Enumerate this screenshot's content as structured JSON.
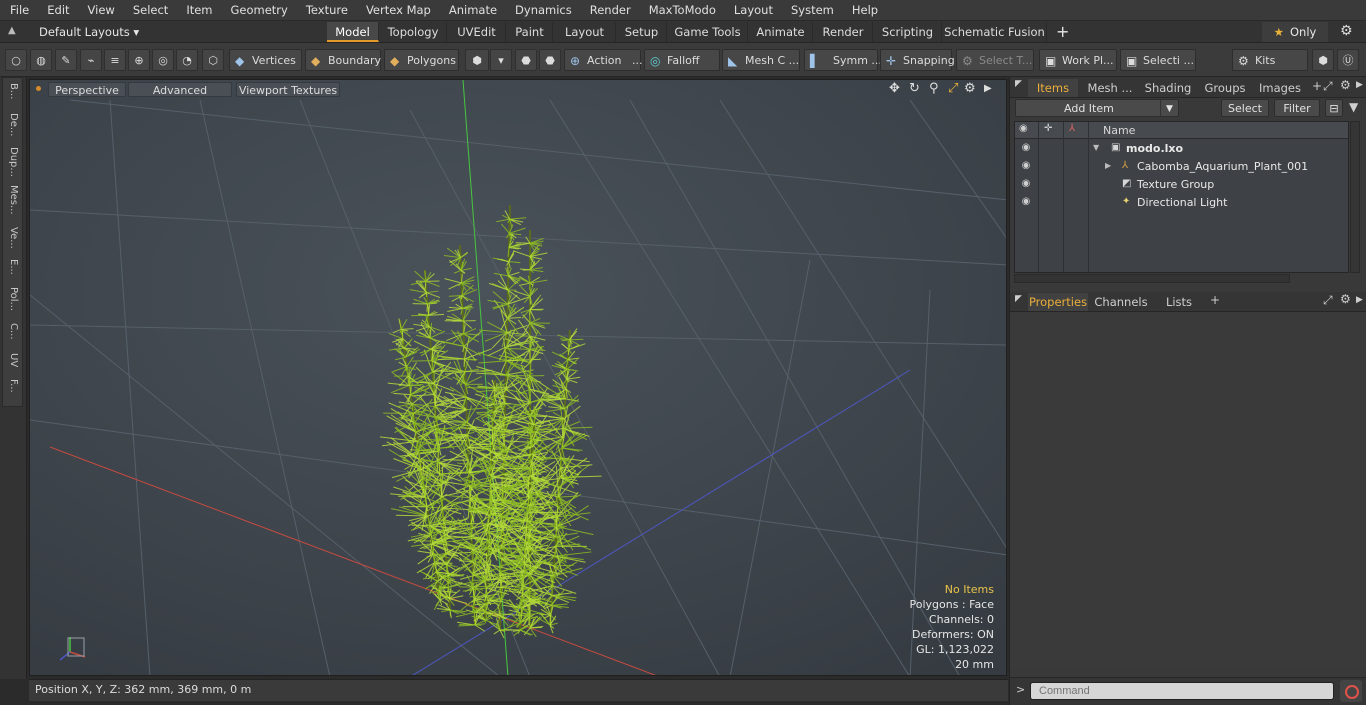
{
  "menubar": {
    "items": [
      "File",
      "Edit",
      "View",
      "Select",
      "Item",
      "Geometry",
      "Texture",
      "Vertex Map",
      "Animate",
      "Dynamics",
      "Render",
      "MaxToModo",
      "Layout",
      "System",
      "Help"
    ]
  },
  "layoutbar": {
    "layouts_label": "Default Layouts",
    "tabs": [
      "Model",
      "Topology",
      "UVEdit",
      "Paint",
      "Layout",
      "Setup",
      "Game Tools",
      "Animate",
      "Render",
      "Scripting",
      "Schematic Fusion"
    ],
    "active_tab": "Model",
    "plus": "+",
    "only_label": "Only"
  },
  "toolbar": {
    "vertices": "Vertices",
    "boundary": "Boundary",
    "polygons": "Polygons",
    "action": "Action",
    "action_more": "...",
    "falloff": "Falloff",
    "mesh_c": "Mesh C ...",
    "symm": "Symm ...",
    "snapping": "Snapping",
    "select_t": "Select T...",
    "work_pl": "Work Pl...",
    "selecti": "Selecti ...",
    "kits": "Kits"
  },
  "left_tabs": [
    "B...",
    "De...",
    "Dup...",
    "Mes...",
    "Ve...",
    "E...",
    "Pol...",
    "C...",
    "UV",
    "F..."
  ],
  "viewport": {
    "perspective": "Perspective",
    "advanced": "Advanced",
    "viewport_textures": "Viewport Textures",
    "info": {
      "no_items": "No Items",
      "polygons": "Polygons : Face",
      "channels": "Channels: 0",
      "deformers": "Deformers: ON",
      "gl": "GL: 1,123,022",
      "scale": "20 mm"
    },
    "axis_colors": {
      "x": "#d9564a",
      "y": "#4fd14a",
      "z": "#5a64d8"
    },
    "plant_colors": {
      "leaf": "#8dbd22",
      "leaf_light": "#b6dc3a",
      "stem": "#5b6a1c"
    }
  },
  "statusbar": {
    "position": "Position X, Y, Z:   362 mm, 369 mm, 0 m"
  },
  "items_panel": {
    "tabs": [
      "Items",
      "Mesh ...",
      "Shading",
      "Groups",
      "Images"
    ],
    "active_tab": "Items",
    "add_item": "Add Item",
    "select": "Select",
    "filter": "Filter",
    "column_name": "Name",
    "rows": [
      {
        "label": "modo.lxo",
        "icon": "scene-icon"
      },
      {
        "label": "Cabomba_Aquarium_Plant_001",
        "icon": "mesh-icon"
      },
      {
        "label": "Texture Group",
        "icon": "texture-group-icon"
      },
      {
        "label": "Directional Light",
        "icon": "light-icon"
      }
    ]
  },
  "properties_panel": {
    "tabs": [
      "Properties",
      "Channels",
      "Lists"
    ],
    "active_tab": "Properties",
    "plus": "+"
  },
  "command": {
    "placeholder": "Command",
    "caret": ">"
  }
}
